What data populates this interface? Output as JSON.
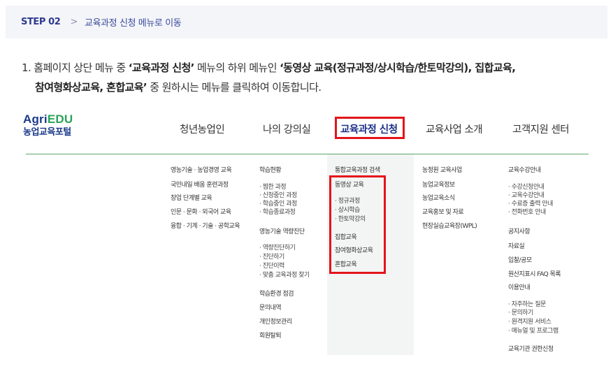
{
  "step": {
    "label": "STEP 02",
    "separator": ">",
    "description": "교육과정 신청 메뉴로 이동"
  },
  "instruction": {
    "line1_prefix": "1. 홈페이지 상단 메뉴 중 ",
    "line1_bold1": "‘교육과정 신청’",
    "line1_mid": " 메뉴의 하위 메뉴인 ",
    "line1_bold2": "‘동영상 교육(정규과정/상시학습/한토막강의), 집합교육,",
    "line2_bold": "참여형화상교육, 혼합교육’",
    "line2_suffix": " 중 원하시는 메뉴를 클릭하여 이동합니다."
  },
  "logo": {
    "agri": "Agri",
    "edu": "EDU",
    "subtitle": "농업교육포털"
  },
  "gnb": [
    "청년농업인",
    "나의 강의실",
    "교육과정 신청",
    "교육사업 소개",
    "고객지원 센터"
  ],
  "submenu": {
    "col1": [
      "영농기술 · 농업경영 교육",
      "국민내일 배움 훈련과정",
      "창업 단계별 교육",
      "인문 · 문화 · 외국어 교육",
      "융합 · 기계 · 기술 · 공학교육"
    ],
    "col2": [
      "학습현황",
      "· 찜한 과정",
      "· 신청중인 과정",
      "· 학습중인 과정",
      "· 학습종료과정",
      "영농기술 역량진단",
      "· 역량진단하기",
      "· 진단하기",
      "· 진단이력",
      "· 맞춤 교육과정 찾기",
      "학습환경 점검",
      "문의내역",
      "개인정보관리",
      "회원탈퇴"
    ],
    "col3": [
      "통합교육과정 검색",
      "동영상 교육",
      "· 정규과정",
      "· 상시학습",
      "· 한토막강의",
      "집합교육",
      "참여형화상교육",
      "혼합교육"
    ],
    "col4": [
      "농정원 교육사업",
      "농업교육정보",
      "농업교육소식",
      "교육홍보 및 자료",
      "현장실습교육장(WPL)"
    ],
    "col5": [
      "교육수강안내",
      "· 수강신청안내",
      "· 교육수강안내",
      "· 수료증 출력 안내",
      "· 전화번호 안내",
      "공지사항",
      "자료실",
      "입찰/공모",
      "원산지표시 FAQ 목록",
      "이용안내",
      "· 자주하는 질문",
      "· 문의하기",
      "· 원격지원 서비스",
      "· 매뉴얼 및 프로그램",
      "교육기관 권한신청"
    ]
  },
  "colors": {
    "highlight": "#e4141b",
    "brand": "#1b3a8a",
    "edu_green": "#2aa356",
    "divider": "#5aa66a"
  }
}
